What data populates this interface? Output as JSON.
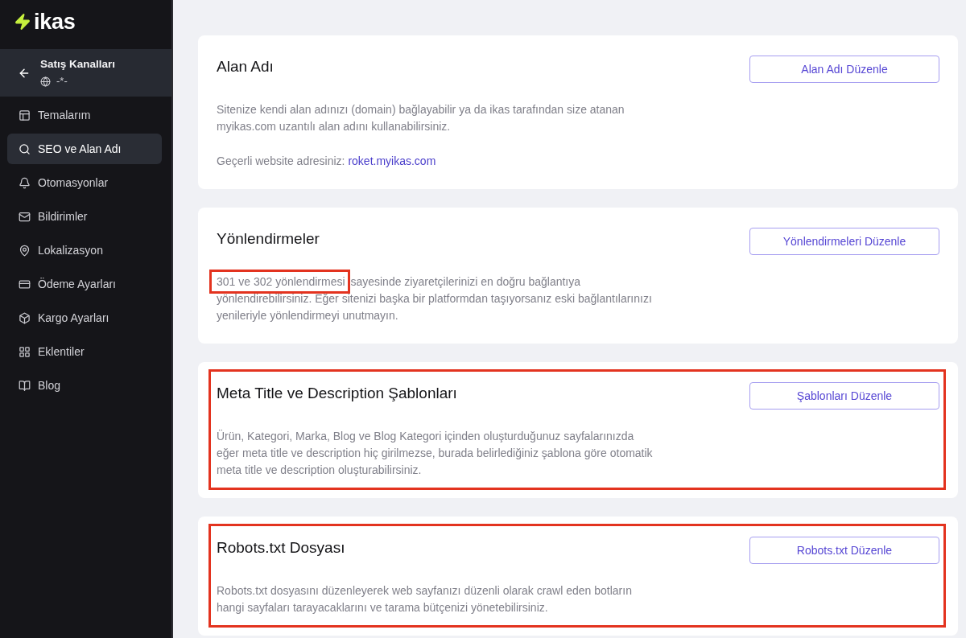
{
  "logo": {
    "text": "ikas"
  },
  "sidebar": {
    "channel": {
      "title": "Satış Kanalları",
      "subtitle": "-*-"
    },
    "items": [
      {
        "label": "Temalarım",
        "selected": false
      },
      {
        "label": "SEO ve Alan Adı",
        "selected": true
      },
      {
        "label": "Otomasyonlar",
        "selected": false
      },
      {
        "label": "Bildirimler",
        "selected": false
      },
      {
        "label": "Lokalizasyon",
        "selected": false
      },
      {
        "label": "Ödeme Ayarları",
        "selected": false
      },
      {
        "label": "Kargo Ayarları",
        "selected": false
      },
      {
        "label": "Eklentiler",
        "selected": false
      },
      {
        "label": "Blog",
        "selected": false
      }
    ]
  },
  "cards": [
    {
      "title": "Alan Adı",
      "button": "Alan Adı Düzenle",
      "highlighted": false,
      "paragraphs": [
        {
          "text": "Sitenize kendi alan adınızı (domain) bağlayabilir ya da ikas tarafından size atanan myikas.com uzantılı alan adını kullanabilirsiniz."
        },
        {
          "text": "Geçerli website adresiniz:",
          "link": "roket.myikas.com"
        }
      ]
    },
    {
      "title": "Yönlendirmeler",
      "button": "Yönlendirmeleri Düzenle",
      "highlighted": false,
      "paragraphs": [
        {
          "marked": "301 ve 302 yönlendirmesi",
          "text": "sayesinde ziyaretçilerinizi en doğru bağlantıya yönlendirebilirsiniz. Eğer sitenizi başka bir platformdan taşıyorsanız eski bağlantılarınızı yenileriyle yönlendirmeyi unutmayın."
        }
      ]
    },
    {
      "title": "Meta Title ve Description Şablonları",
      "button": "Şablonları Düzenle",
      "highlighted": true,
      "paragraphs": [
        {
          "text": "Ürün, Kategori, Marka, Blog ve Blog Kategori içinden oluşturduğunuz sayfalarınızda eğer meta title ve description hiç girilmezse, burada belirlediğiniz şablona göre otomatik meta title ve description oluşturabilirsiniz."
        }
      ]
    },
    {
      "title": "Robots.txt Dosyası",
      "button": "Robots.txt Düzenle",
      "highlighted": true,
      "paragraphs": [
        {
          "text": "Robots.txt dosyasını düzenleyerek web sayfanızı düzenli olarak crawl eden botların hangi sayfaları tarayacaklarını ve tarama bütçenizi yönetebilirsiniz."
        }
      ]
    }
  ]
}
